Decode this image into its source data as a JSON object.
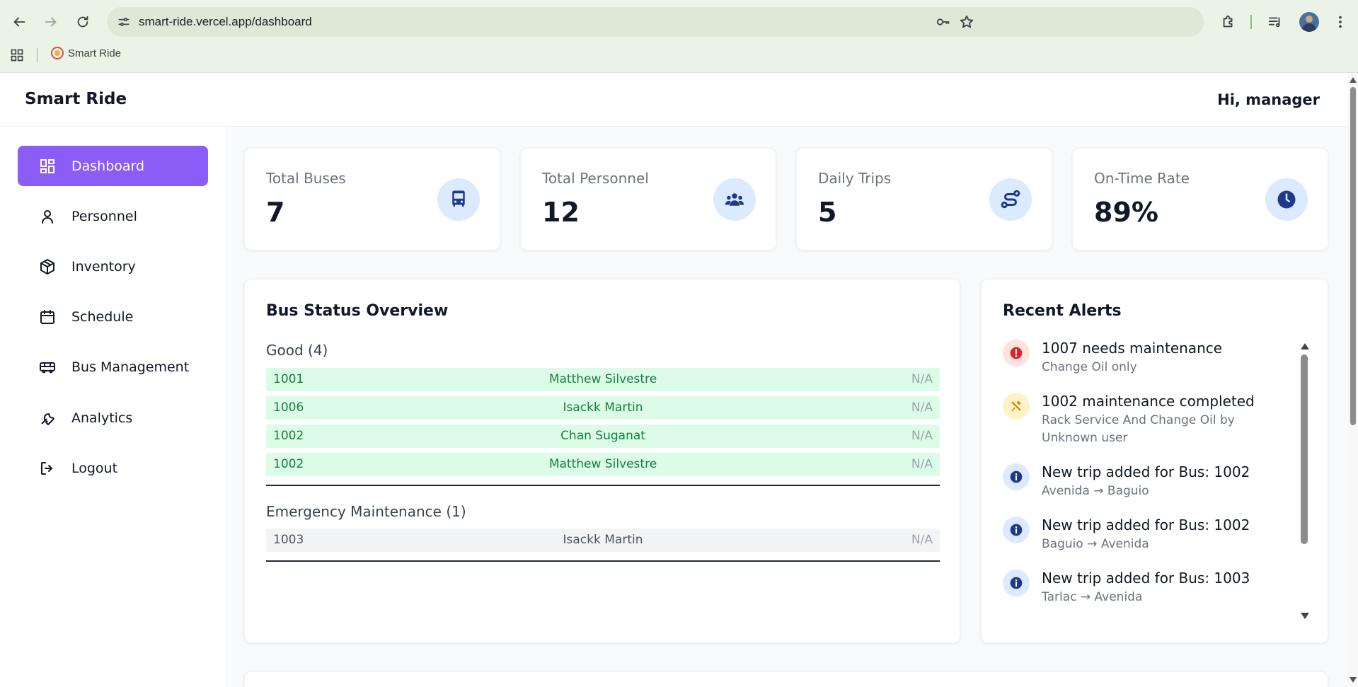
{
  "browser": {
    "url": "smart-ride.vercel.app/dashboard",
    "bookmark_label": "Smart Ride"
  },
  "app": {
    "brand": "Smart Ride",
    "greeting": "Hi, manager"
  },
  "sidebar": {
    "items": [
      {
        "label": "Dashboard",
        "icon": "dashboard-icon",
        "active": true
      },
      {
        "label": "Personnel",
        "icon": "user-icon"
      },
      {
        "label": "Inventory",
        "icon": "box-icon"
      },
      {
        "label": "Schedule",
        "icon": "calendar-icon"
      },
      {
        "label": "Bus Management",
        "icon": "bus-icon"
      },
      {
        "label": "Analytics",
        "icon": "wrench-icon"
      },
      {
        "label": "Logout",
        "icon": "logout-icon"
      }
    ]
  },
  "stats": [
    {
      "label": "Total Buses",
      "value": "7",
      "icon": "bus-icon"
    },
    {
      "label": "Total Personnel",
      "value": "12",
      "icon": "users-icon"
    },
    {
      "label": "Daily Trips",
      "value": "5",
      "icon": "route-icon"
    },
    {
      "label": "On-Time Rate",
      "value": "89%",
      "icon": "clock-icon"
    }
  ],
  "bus_status": {
    "title": "Bus Status Overview",
    "groups": [
      {
        "title": "Good (4)",
        "rows": [
          {
            "bus": "1001",
            "driver": "Matthew Silvestre",
            "extra": "N/A"
          },
          {
            "bus": "1006",
            "driver": "Isackk Martin",
            "extra": "N/A"
          },
          {
            "bus": "1002",
            "driver": "Chan Suganat",
            "extra": "N/A"
          },
          {
            "bus": "1002",
            "driver": "Matthew Silvestre",
            "extra": "N/A"
          }
        ]
      },
      {
        "title": "Emergency Maintenance (1)",
        "rows": [
          {
            "bus": "1003",
            "driver": "Isackk Martin",
            "extra": "N/A"
          }
        ]
      }
    ]
  },
  "alerts": {
    "title": "Recent Alerts",
    "items": [
      {
        "title": "1007 needs maintenance",
        "subtitle": "Change Oil only",
        "icon": "alert-circle-icon",
        "tone": "red"
      },
      {
        "title": "1002 maintenance completed",
        "subtitle": "Rack Service And Change Oil by Unknown user",
        "icon": "tools-icon",
        "tone": "yellow"
      },
      {
        "title": "New trip added for Bus: 1002",
        "subtitle": "Avenida → Baguio",
        "icon": "info-icon",
        "tone": "blue"
      },
      {
        "title": "New trip added for Bus: 1002",
        "subtitle": "Baguio → Avenida",
        "icon": "info-icon",
        "tone": "blue"
      },
      {
        "title": "New trip added for Bus: 1003",
        "subtitle": "Tarlac → Avenida",
        "icon": "info-icon",
        "tone": "blue"
      }
    ]
  },
  "colors": {
    "accent": "#8b5cf6",
    "good_row_bg": "#dcfce7",
    "good_row_text": "#15803d",
    "icon_badge_bg": "#dbeafe",
    "icon_badge_fg": "#1e3a8a"
  }
}
